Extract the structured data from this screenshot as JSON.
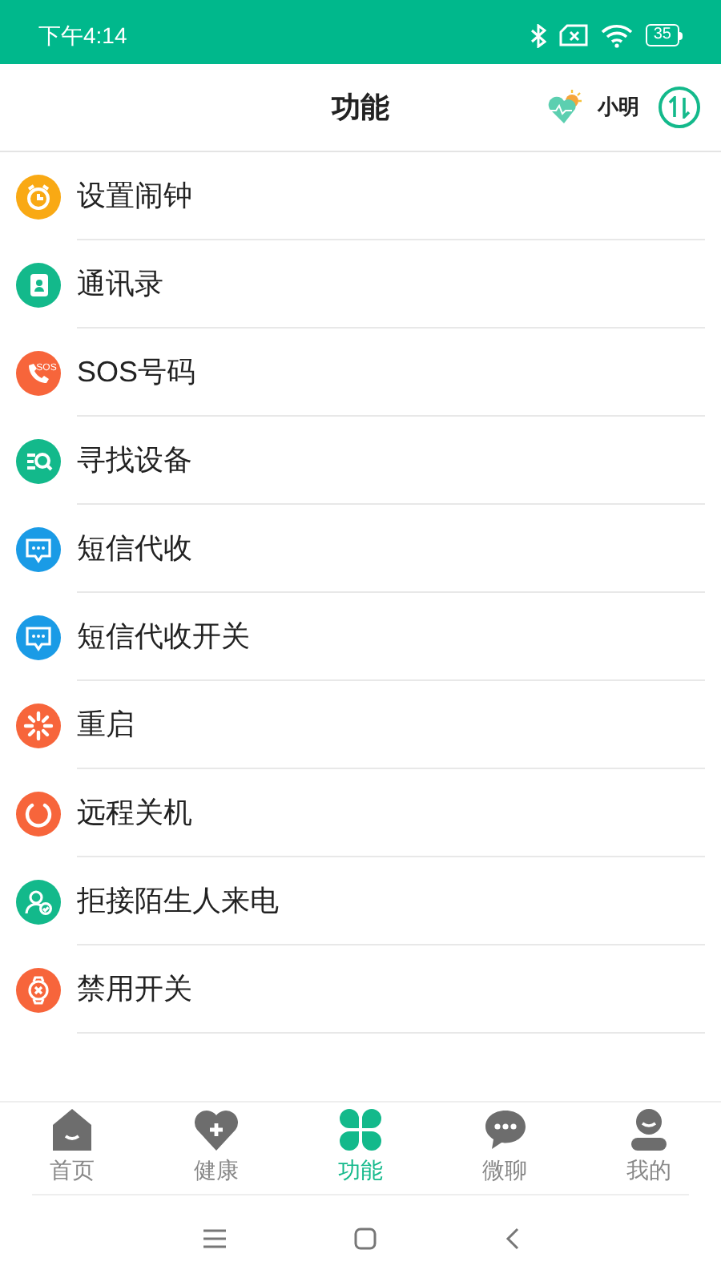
{
  "status_bar": {
    "time": "下午4:14",
    "battery": "35"
  },
  "header": {
    "title": "功能",
    "user": "小明"
  },
  "items": [
    {
      "label": "设置闹钟",
      "kind": "alarm",
      "color": "#f9a914"
    },
    {
      "label": "通讯录",
      "kind": "contacts",
      "color": "#13b98b"
    },
    {
      "label": "SOS号码",
      "kind": "sos",
      "color": "#f7653b",
      "icon_text": "SOS"
    },
    {
      "label": "寻找设备",
      "kind": "search",
      "color": "#13b98b"
    },
    {
      "label": "短信代收",
      "kind": "sms",
      "color": "#1a9be6"
    },
    {
      "label": "短信代收开关",
      "kind": "sms",
      "color": "#1a9be6"
    },
    {
      "label": "重启",
      "kind": "restart",
      "color": "#f7653b"
    },
    {
      "label": "远程关机",
      "kind": "power",
      "color": "#f7653b"
    },
    {
      "label": "拒接陌生人来电",
      "kind": "person",
      "color": "#13b98b"
    },
    {
      "label": "禁用开关",
      "kind": "watch",
      "color": "#f7653b"
    }
  ],
  "tabs": [
    {
      "label": "首页",
      "kind": "home",
      "selected": false
    },
    {
      "label": "健康",
      "kind": "health",
      "selected": false
    },
    {
      "label": "功能",
      "kind": "clover",
      "selected": true
    },
    {
      "label": "微聊",
      "kind": "chat",
      "selected": false
    },
    {
      "label": "我的",
      "kind": "me",
      "selected": false
    }
  ]
}
